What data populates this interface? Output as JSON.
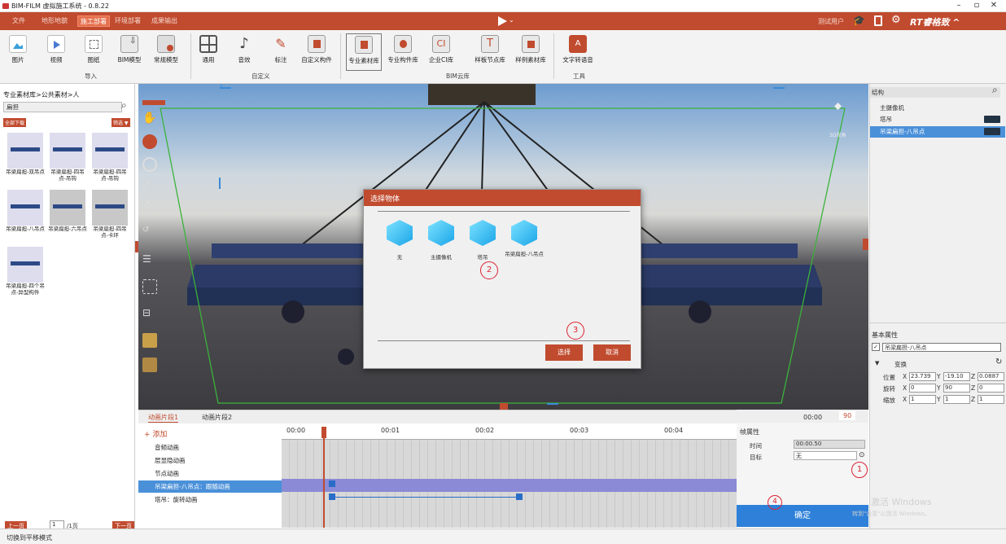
{
  "window": {
    "title": "BIM-FILM 虚拟施工系统 - 0.8.22",
    "min": "–",
    "max": "▫",
    "close": "✕"
  },
  "menu": {
    "tabs": [
      "文件",
      "地形地貌",
      "施工部署",
      "环境部署",
      "成果输出"
    ],
    "active_index": 2,
    "user": "测试用户",
    "brand": "RT睿格致 ^"
  },
  "ribbon": {
    "import_buttons": [
      "图片",
      "视频",
      "图纸",
      "BIM模型",
      "常规模型"
    ],
    "custom_buttons": [
      "通用",
      "音效",
      "标注",
      "自定义构件"
    ],
    "cloud_buttons": [
      "专业素材库",
      "专业构件库",
      "企业CI库",
      "样板节点库",
      "样例素材库"
    ],
    "tool_buttons": [
      "文字转语音"
    ],
    "groups": [
      "导入",
      "自定义",
      "BIM云库",
      "工具"
    ]
  },
  "left": {
    "breadcrumb": "专业素材库>公共素材>人",
    "search_value": "扁担",
    "download_all": "全部下载",
    "filter": "筛选 ▼",
    "items": [
      "吊梁扁担-双吊点",
      "吊梁扁担-四吊点-吊钩",
      "吊梁扁担-四吊点-吊钩",
      "吊梁扁担-八吊点",
      "吊梁扁担-六吊点",
      "吊梁扁担-四吊点-卡环",
      "吊梁扁担-四个吊点-异型构件"
    ],
    "pager": {
      "prev": "上一页",
      "page": "1",
      "total": "/1页",
      "next": "下一页"
    }
  },
  "viewport": {
    "view_label": "3D视角"
  },
  "dialog": {
    "title": "选择物体",
    "items": [
      "无",
      "主摄像机",
      "塔吊",
      "吊梁扁担-八吊点"
    ],
    "select": "选择",
    "cancel": "取消",
    "mark2": "2",
    "mark3": "3"
  },
  "right": {
    "structure_label": "结构",
    "tree": [
      "主摄像机",
      "塔吊",
      "吊梁扁担-八吊点"
    ],
    "basic_props": "基本属性",
    "name_value": "吊梁扁担-八吊点",
    "transform": "变换",
    "pos_label": "位置",
    "rot_label": "旋转",
    "scale_label": "缩放",
    "pos": {
      "x": "23.739",
      "y": "-19.10",
      "z": "0.0887"
    },
    "rot": {
      "x": "0",
      "y": "90",
      "z": "0"
    },
    "scale": {
      "x": "1",
      "y": "1",
      "z": "1"
    }
  },
  "timeline": {
    "tabs": [
      "动画片段1",
      "动画片段2"
    ],
    "add": "+ 添加",
    "tracks": [
      "音频动画",
      "层显隐动画",
      "节点动画",
      "吊梁扁担-八吊点：跟随动画",
      "塔吊：旋转动画"
    ],
    "ticks": [
      "00:00",
      "00:01",
      "00:02",
      "00:03",
      "00:04"
    ],
    "time": "00:00",
    "frame": "90"
  },
  "frame": {
    "title": "帧属性",
    "time_label": "时间",
    "time_value": "00:00.50",
    "target_label": "目标",
    "target_value": "无",
    "confirm": "确定",
    "mark1": "1",
    "mark4": "4"
  },
  "status": {
    "text": "切换到平移模式"
  },
  "watermark": {
    "line1": "激活 Windows",
    "line2": "转到\"设置\"以激活 Windows。"
  }
}
